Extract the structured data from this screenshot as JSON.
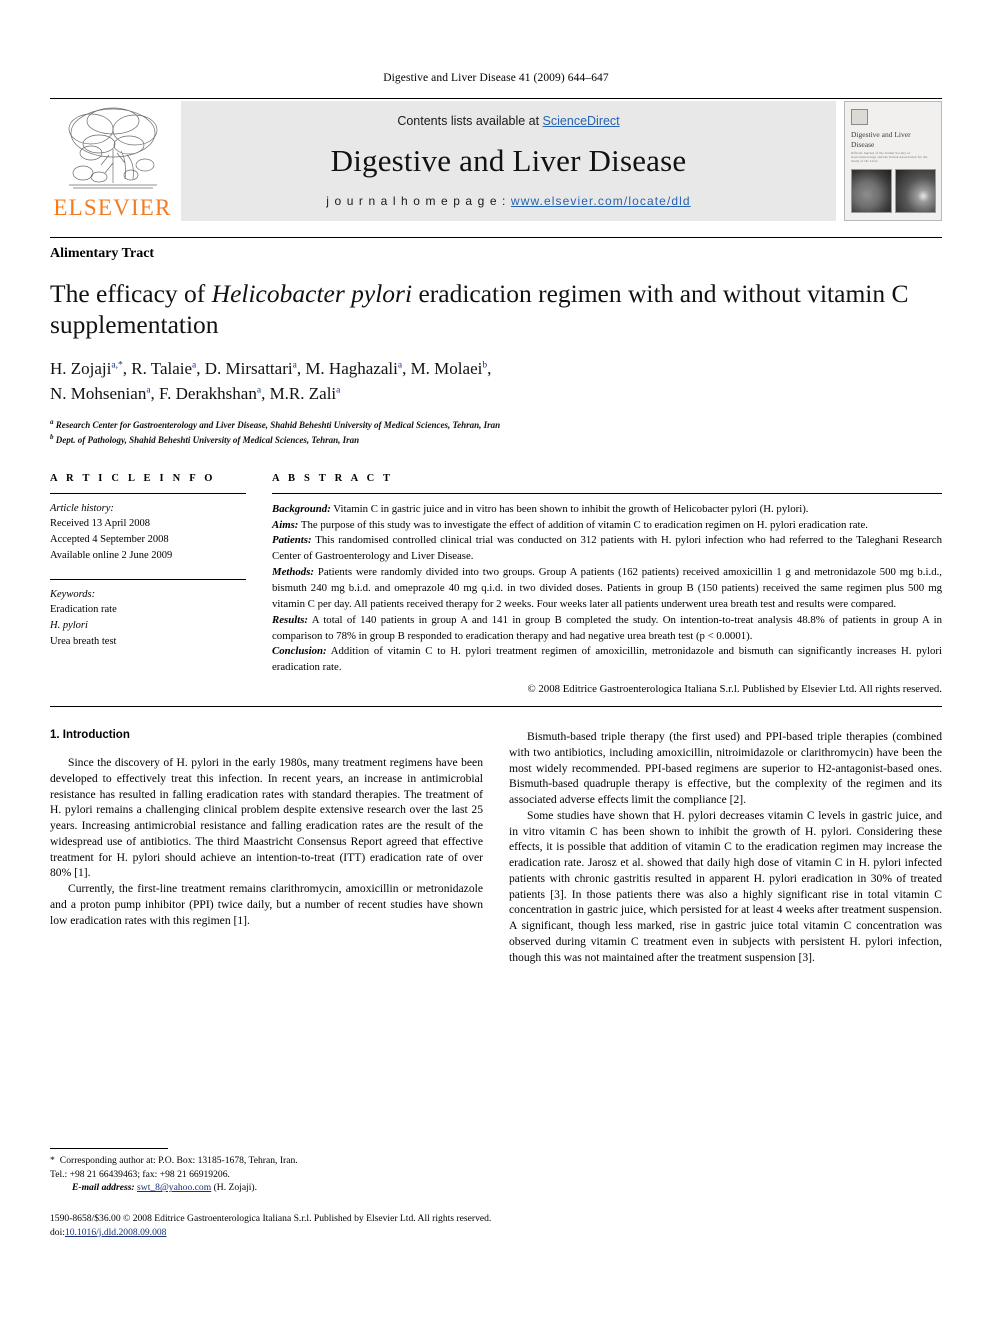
{
  "running_head": "Digestive and Liver Disease 41 (2009) 644–647",
  "masthead": {
    "publisher_name": "ELSEVIER",
    "contents_prefix": "Contents lists available at ",
    "contents_link": "ScienceDirect",
    "journal_name": "Digestive and Liver Disease",
    "homepage_prefix": "j o u r n a l   h o m e p a g e :   ",
    "homepage_url": "www.elsevier.com/locate/dld",
    "cover_title": "Digestive and Liver Disease",
    "cover_subtitle": "Official Journal of the Italian Society of Gastroenterology and the Italian Association for the Study of the Liver"
  },
  "article": {
    "section_label": "Alimentary Tract",
    "title_part1": "The efficacy of ",
    "title_italic1": "Helicobacter pylori",
    "title_part2": " eradication regimen with and without vitamin C supplementation",
    "authors_line1": "H. Zojaji",
    "authors_line_full": "H. Zojaji a,*, R. Talaie a, D. Mirsattari a, M. Haghazali a, M. Molaei b, N. Mohsenian a, F. Derakhshan a, M.R. Zali a",
    "affiliation_a": "Research Center for Gastroenterology and Liver Disease, Shahid Beheshti University of Medical Sciences, Tehran, Iran",
    "affiliation_b": "Dept. of Pathology, Shahid Beheshti University of Medical Sciences, Tehran, Iran"
  },
  "article_info": {
    "heading": "A R T I C L E   I N F O",
    "history_label": "Article history:",
    "received": "Received 13 April 2008",
    "accepted": "Accepted 4 September 2008",
    "available": "Available online 2 June 2009",
    "keywords_label": "Keywords:",
    "keywords": [
      "Eradication rate",
      "H. pylori",
      "Urea breath test"
    ]
  },
  "abstract": {
    "heading": "A B S T R A C T",
    "background_label": "Background:",
    "background_text": " Vitamin C in gastric juice and in vitro has been shown to inhibit the growth of Helicobacter pylori (H. pylori).",
    "aims_label": "Aims:",
    "aims_text": " The purpose of this study was to investigate the effect of addition of vitamin C to eradication regimen on H. pylori eradication rate.",
    "patients_label": "Patients:",
    "patients_text": " This randomised controlled clinical trial was conducted on 312 patients with H. pylori infection who had referred to the Taleghani Research Center of Gastroenterology and Liver Disease.",
    "methods_label": "Methods:",
    "methods_text": " Patients were randomly divided into two groups. Group A patients (162 patients) received amoxicillin 1 g and metronidazole 500 mg b.i.d., bismuth 240 mg b.i.d. and omeprazole 40 mg q.i.d. in two divided doses. Patients in group B (150 patients) received the same regimen plus 500 mg vitamin C per day. All patients received therapy for 2 weeks. Four weeks later all patients underwent urea breath test and results were compared.",
    "results_label": "Results:",
    "results_text": " A total of 140 patients in group A and 141 in group B completed the study. On intention-to-treat analysis 48.8% of patients in group A in comparison to 78% in group B responded to eradication therapy and had negative urea breath test (p < 0.0001).",
    "conclusion_label": "Conclusion:",
    "conclusion_text": " Addition of vitamin C to H. pylori treatment regimen of amoxicillin, metronidazole and bismuth can significantly increases H. pylori eradication rate.",
    "copyright": "© 2008 Editrice Gastroenterologica Italiana S.r.l. Published by Elsevier Ltd. All rights reserved."
  },
  "body": {
    "intro_heading": "1.  Introduction",
    "left_p1": "Since the discovery of H. pylori in the early 1980s, many treatment regimens have been developed to effectively treat this infection. In recent years, an increase in antimicrobial resistance has resulted in falling eradication rates with standard therapies. The treatment of H. pylori remains a challenging clinical problem despite extensive research over the last 25 years. Increasing antimicrobial resistance and falling eradication rates are the result of the widespread use of antibiotics. The third Maastricht Consensus Report agreed that effective treatment for H. pylori should achieve an intention-to-treat (ITT) eradication rate of over 80% [1].",
    "left_p2": "Currently, the first-line treatment remains clarithromycin, amoxicillin or metronidazole and a proton pump inhibitor (PPI) twice daily, but a number of recent studies have shown low eradication rates with this regimen [1].",
    "right_p1": "Bismuth-based triple therapy (the first used) and PPI-based triple therapies (combined with two antibiotics, including amoxicillin, nitroimidazole or clarithromycin) have been the most widely recommended. PPI-based regimens are superior to H2-antagonist-based ones. Bismuth-based quadruple therapy is effective, but the complexity of the regimen and its associated adverse effects limit the compliance [2].",
    "right_p2": "Some studies have shown that H. pylori decreases vitamin C levels in gastric juice, and in vitro vitamin C has been shown to inhibit the growth of H. pylori. Considering these effects, it is possible that addition of vitamin C to the eradication regimen may increase the eradication rate. Jarosz et al. showed that daily high dose of vitamin C in H. pylori infected patients with chronic gastritis resulted in apparent H. pylori eradication in 30% of treated patients [3]. In those patients there was also a highly significant rise in total vitamin C concentration in gastric juice, which persisted for at least 4 weeks after treatment suspension. A significant, though less marked, rise in gastric juice total vitamin C concentration was observed during vitamin C treatment even in subjects with persistent H. pylori infection, though this was not maintained after the treatment suspension [3]."
  },
  "footnote": {
    "star": "*",
    "corresponding": "Corresponding author at: P.O. Box: 13185-1678, Tehran, Iran.",
    "tel_fax": "Tel.: +98 21 66439463; fax: +98 21 66919206.",
    "email_label": "E-mail address:",
    "email": "swt_8@yahoo.com",
    "email_owner": " (H. Zojaji)."
  },
  "page_footer": {
    "issn_line": "1590-8658/$36.00 © 2008 Editrice Gastroenterologica Italiana S.r.l. Published by Elsevier Ltd. All rights reserved.",
    "doi_label": "doi:",
    "doi_value": "10.1016/j.dld.2008.09.008"
  },
  "colors": {
    "elsevier_orange": "#F47B20",
    "link_blue": "#2763b0",
    "reference_blue": "#16307a",
    "masthead_grey": "#e8e8e8"
  }
}
